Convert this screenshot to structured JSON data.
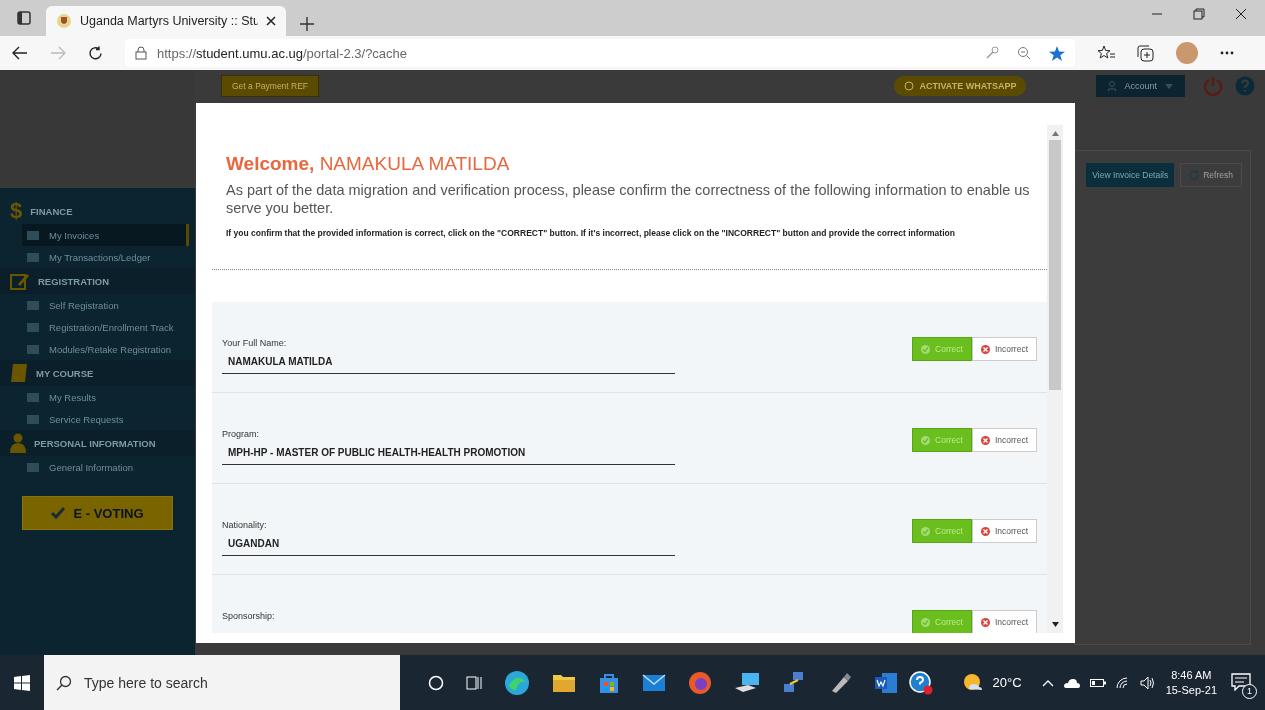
{
  "browser": {
    "tab_title": "Uganda Martyrs University :: Stu",
    "url_scheme": "https://",
    "url_host": "student.umu.ac.ug",
    "url_path": "/portal-2.3/?cache"
  },
  "top_bar": {
    "payment_button": "Get a Payment REF",
    "whatsapp_button": "ACTIVATE WHATSAPP",
    "account_button": "Account"
  },
  "sidebar": {
    "symbol": "$",
    "sections": [
      {
        "title": "FINANCE",
        "items": [
          {
            "label": "My Invoices",
            "selected": true
          },
          {
            "label": "My Transactions/Ledger",
            "selected": false
          }
        ]
      },
      {
        "title": "REGISTRATION",
        "items": [
          {
            "label": "Self Registration",
            "selected": false
          },
          {
            "label": "Registration/Enrollment Track",
            "selected": false
          },
          {
            "label": "Modules/Retake Registration",
            "selected": false
          }
        ]
      },
      {
        "title": "MY COURSE",
        "items": [
          {
            "label": "My Results",
            "selected": false
          },
          {
            "label": "Service Requests",
            "selected": false
          }
        ]
      },
      {
        "title": "PERSONAL INFORMATION",
        "items": [
          {
            "label": "General Information",
            "selected": false
          }
        ]
      }
    ],
    "voting_button": "E - VOTING"
  },
  "panel": {
    "details_button": "View Invoice Details",
    "refresh_button": "Refresh"
  },
  "modal": {
    "welcome": "Welcome,",
    "name": "NAMAKULA MATILDA",
    "intro": "As part of the data migration and verification process, please confirm the correctness of the following information to enable us serve you better.",
    "instruction": "If you confirm that the provided information is correct, click on the \"CORRECT\" button. If it's incorrect, please click on the \"INCORRECT\" button and provide the correct information",
    "fields": [
      {
        "label": "Your Full Name:",
        "value": "NAMAKULA MATILDA",
        "correct": "Correct",
        "incorrect": "Incorrect"
      },
      {
        "label": "Program:",
        "value": "MPH-HP - MASTER OF PUBLIC HEALTH-HEALTH PROMOTION",
        "correct": "Correct",
        "incorrect": "Incorrect"
      },
      {
        "label": "Nationality:",
        "value": "UGANDAN",
        "correct": "Correct",
        "incorrect": "Incorrect"
      },
      {
        "label": "Sponsorship:",
        "correct": "Correct",
        "incorrect": "Incorrect"
      }
    ]
  },
  "taskbar": {
    "search_placeholder": "Type here to search",
    "temperature": "20°C",
    "time": "8:46 AM",
    "date": "15-Sep-21",
    "notification_count": "1"
  }
}
